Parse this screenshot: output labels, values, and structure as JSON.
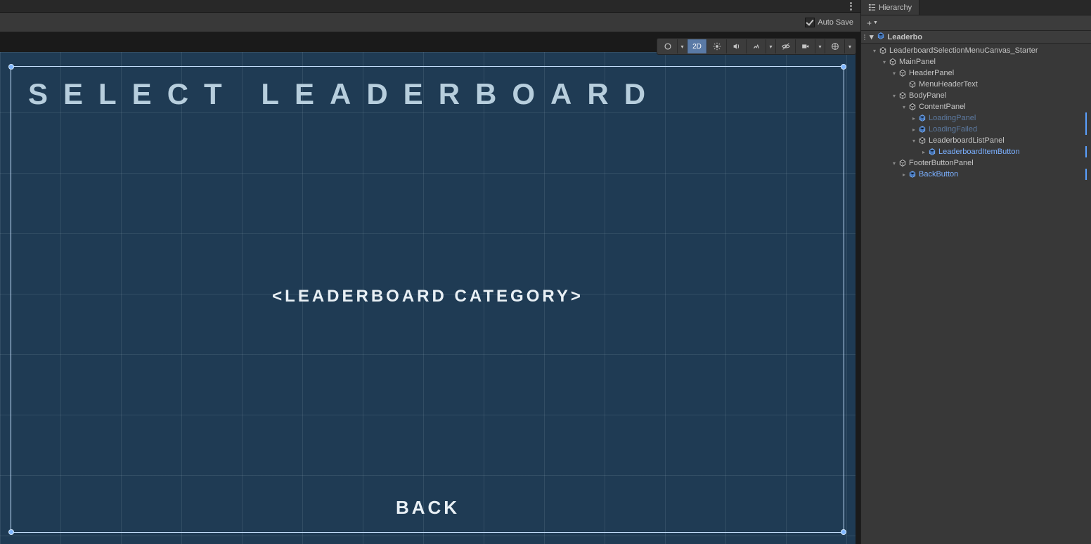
{
  "tabs": {
    "hierarchy": "Hierarchy"
  },
  "topbar": {
    "autoSaveLabel": "Auto Save",
    "autoSaveChecked": true,
    "twoDLabel": "2D"
  },
  "sceneHeader": {
    "sceneName": "Leaderbo"
  },
  "gameUI": {
    "title": "SELECT LEADERBOARD",
    "category": "<LEADERBOARD CATEGORY>",
    "back": "BACK"
  },
  "hierarchy": [
    {
      "name": "LeaderboardSelectionMenuCanvas_Starter",
      "depth": 0,
      "kind": "go",
      "expanded": true,
      "hasChildren": true
    },
    {
      "name": "MainPanel",
      "depth": 1,
      "kind": "go",
      "expanded": true,
      "hasChildren": true
    },
    {
      "name": "HeaderPanel",
      "depth": 2,
      "kind": "go",
      "expanded": true,
      "hasChildren": true
    },
    {
      "name": "MenuHeaderText",
      "depth": 3,
      "kind": "go",
      "expanded": false,
      "hasChildren": false
    },
    {
      "name": "BodyPanel",
      "depth": 2,
      "kind": "go",
      "expanded": true,
      "hasChildren": true
    },
    {
      "name": "ContentPanel",
      "depth": 3,
      "kind": "go",
      "expanded": true,
      "hasChildren": true
    },
    {
      "name": "LoadingPanel",
      "depth": 4,
      "kind": "prefab",
      "expanded": false,
      "hasChildren": true,
      "disabled": true,
      "override": true
    },
    {
      "name": "LoadingFailed",
      "depth": 4,
      "kind": "prefab",
      "expanded": false,
      "hasChildren": true,
      "disabled": true,
      "override": true
    },
    {
      "name": "LeaderboardListPanel",
      "depth": 4,
      "kind": "go",
      "expanded": true,
      "hasChildren": true
    },
    {
      "name": "LeaderboardItemButton",
      "depth": 5,
      "kind": "prefab",
      "expanded": false,
      "hasChildren": true,
      "override": true
    },
    {
      "name": "FooterButtonPanel",
      "depth": 2,
      "kind": "go",
      "expanded": true,
      "hasChildren": true
    },
    {
      "name": "BackButton",
      "depth": 3,
      "kind": "prefab",
      "expanded": false,
      "hasChildren": true,
      "override": true
    }
  ]
}
